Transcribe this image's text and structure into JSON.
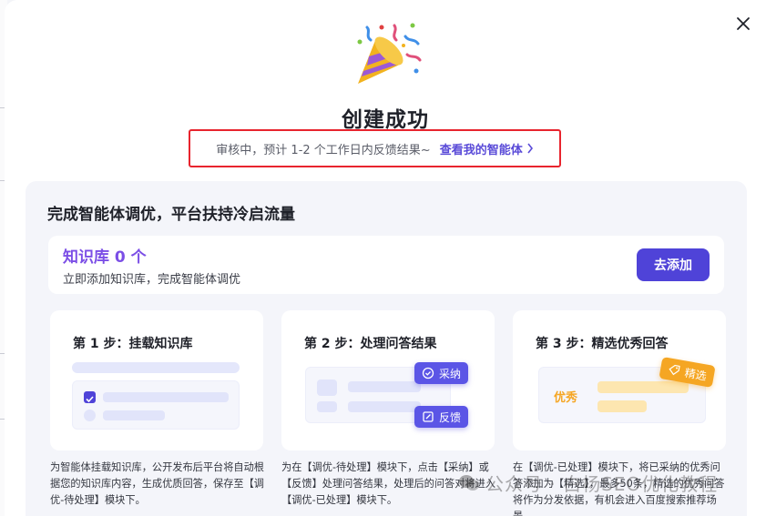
{
  "modal": {
    "title": "创建成功",
    "status_text": "审核中，预计 1-2 个工作日内反馈结果~",
    "view_link_label": "查看我的智能体"
  },
  "panel": {
    "title": "完成智能体调优，平台扶持冷启流量",
    "knowledge_base": {
      "count_label": "知识库 0 个",
      "subtitle": "立即添加知识库，完成智能体调优",
      "add_button_label": "去添加"
    },
    "steps": [
      {
        "title": "第 1 步：挂载知识库",
        "description": "为智能体挂载知识库，公开发布后平台将自动根据您的知识库内容，生成优质回答，保存至【调优-待处理】模块下。"
      },
      {
        "title": "第 2 步：处理问答结果",
        "description": "为在【调优-待处理】模块下，点击【采纳】或【反馈】处理问答结果，处理后的问答对将进入【调优-已处理】模块下。",
        "chips": {
          "accept": "采纳",
          "feedback": "反馈"
        }
      },
      {
        "title": "第 3 步：精选优秀回答",
        "description": "在【调优-已处理】模块下，将已采纳的优秀问答添加为【精选】，最多50条，精选的优秀问答将作为分发依据，有机会进入百度搜索推荐场景。",
        "chips": {
          "featured": "精选"
        },
        "example_label": "优秀"
      }
    ]
  },
  "watermark": "公众号 · 白杨SEO优化教程",
  "colors": {
    "accent": "#4f43d8",
    "highlight_border": "#e8242e",
    "kb_count": "#7b4ee6",
    "featured": "#f5a623"
  }
}
